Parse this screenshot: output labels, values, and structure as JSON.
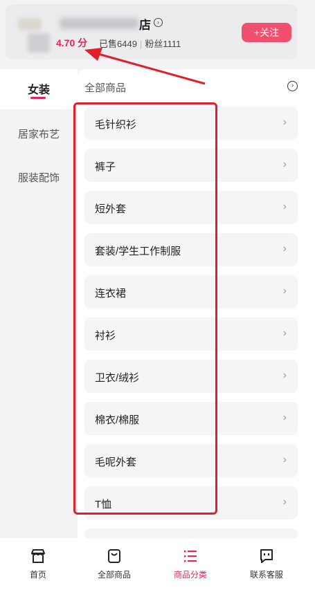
{
  "shop": {
    "name_visible_tail": "店",
    "score": "4.70 分",
    "sold": "已售6449",
    "fans": "粉丝1111",
    "follow_button": "+关注",
    "arrow_glyph": "›"
  },
  "sidebar": {
    "items": [
      {
        "label": "女装",
        "active": true
      },
      {
        "label": "居家布艺",
        "active": false
      },
      {
        "label": "服装配饰",
        "active": false
      }
    ]
  },
  "main": {
    "title": "全部商品",
    "circle_glyph": "›",
    "categories": [
      {
        "label": "毛针织衫"
      },
      {
        "label": "裤子"
      },
      {
        "label": "短外套"
      },
      {
        "label": "套装/学生工作制服"
      },
      {
        "label": "连衣裙"
      },
      {
        "label": "衬衫"
      },
      {
        "label": "卫衣/绒衫"
      },
      {
        "label": "棉衣/棉服"
      },
      {
        "label": "毛呢外套"
      },
      {
        "label": "T恤"
      }
    ],
    "chevron": "›"
  },
  "bottom_nav": {
    "items": [
      {
        "label": "首页",
        "icon": "shop-icon",
        "active": false
      },
      {
        "label": "全部商品",
        "icon": "bag-icon",
        "active": false
      },
      {
        "label": "商品分类",
        "icon": "list-icon",
        "active": true
      },
      {
        "label": "联系客服",
        "icon": "chat-icon",
        "active": false
      }
    ]
  },
  "colors": {
    "accent": "#e0245e",
    "follow_bg": "#f0506e",
    "annotation": "#e01f2b"
  }
}
